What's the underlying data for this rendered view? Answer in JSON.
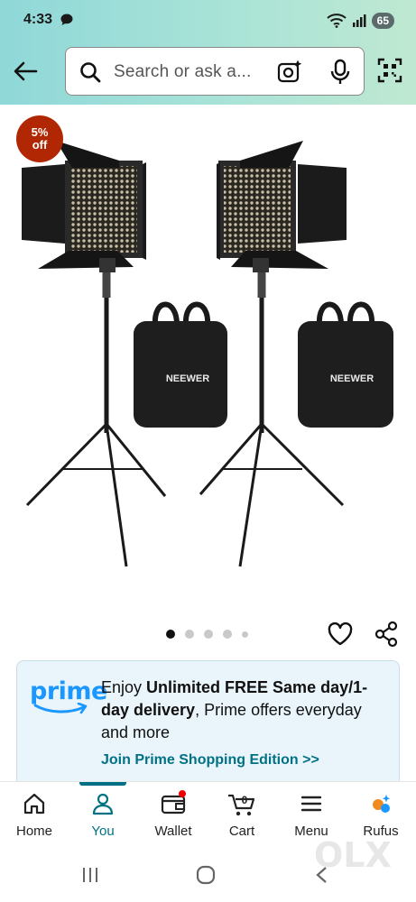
{
  "status": {
    "time": "4:33",
    "battery": "65"
  },
  "search": {
    "placeholder": "Search or ask a..."
  },
  "product": {
    "discount_pct": "5%",
    "discount_word": "off",
    "brand_on_bag": "NEEWER",
    "carousel_pages": 5,
    "carousel_active": 1
  },
  "prime": {
    "logo": "prime",
    "text_prefix": "Enjoy ",
    "text_bold": "Unlimited FREE Same day/1-day delivery",
    "text_suffix": ", Prime offers everyday and more",
    "link": "Join Prime Shopping Edition >>"
  },
  "nav": [
    {
      "label": "Home",
      "icon": "home-icon"
    },
    {
      "label": "You",
      "icon": "person-icon",
      "active": true
    },
    {
      "label": "Wallet",
      "icon": "wallet-icon"
    },
    {
      "label": "Cart",
      "icon": "cart-icon",
      "count": "0"
    },
    {
      "label": "Menu",
      "icon": "menu-icon"
    },
    {
      "label": "Rufus",
      "icon": "rufus-icon"
    }
  ],
  "watermark": "OLX",
  "colors": {
    "accent": "#007185",
    "discount": "#b12704",
    "prime_blue": "#1a98ff"
  }
}
